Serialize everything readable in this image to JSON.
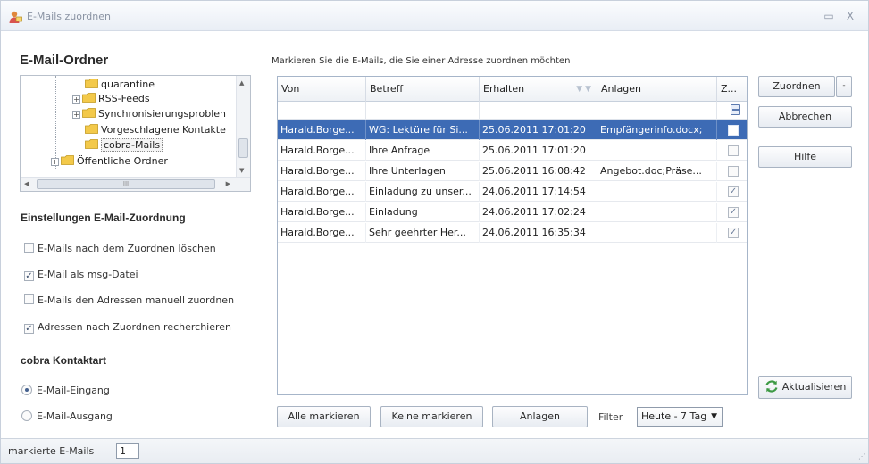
{
  "window": {
    "title": "E-Mails zuordnen",
    "minimize_glyph": "▭",
    "close_glyph": "X"
  },
  "folders": {
    "heading": "E-Mail-Ordner",
    "items": [
      {
        "label": "quarantine",
        "expander": ""
      },
      {
        "label": "RSS-Feeds",
        "expander": "+"
      },
      {
        "label": "Synchronisierungsproblen",
        "expander": "+"
      },
      {
        "label": "Vorgeschlagene Kontakte",
        "expander": ""
      },
      {
        "label": "cobra-Mails",
        "expander": ""
      },
      {
        "label": "Öffentliche Ordner",
        "expander": "+"
      }
    ],
    "scroll_thumb_text": "III"
  },
  "settings": {
    "heading": "Einstellungen E-Mail-Zuordnung",
    "options": [
      {
        "label": "E-Mails nach dem Zuordnen löschen",
        "checked": false,
        "mark": ""
      },
      {
        "label": "E-Mail als msg-Datei",
        "checked": true,
        "mark": "✓"
      },
      {
        "label": "E-Mails den Adressen manuell zuordnen",
        "checked": false,
        "mark": ""
      },
      {
        "label": "Adressen nach Zuordnen recherchieren",
        "checked": true,
        "mark": "✓"
      }
    ]
  },
  "kontaktart": {
    "heading": "cobra Kontaktart",
    "options": [
      {
        "label": "E-Mail-Eingang",
        "selected": true
      },
      {
        "label": "E-Mail-Ausgang",
        "selected": false
      }
    ]
  },
  "grid": {
    "instruction": "Markieren Sie die E-Mails, die Sie einer Adresse zuordnen möchten",
    "columns": [
      "Von",
      "Betreff",
      "Erhalten",
      "Anlagen",
      "Z..."
    ],
    "sort_glyph": "▼ ▼",
    "rows": [
      {
        "von": "Harald.Borge...",
        "betreff": "WG: Lektüre für Si...",
        "erhalten": "25.06.2011 17:01:20",
        "anlagen": "Empfängerinfo.docx;",
        "mark": "",
        "selected": true
      },
      {
        "von": "Harald.Borge...",
        "betreff": "Ihre Anfrage",
        "erhalten": "25.06.2011 17:01:20",
        "anlagen": "",
        "mark": "",
        "selected": false
      },
      {
        "von": "Harald.Borge...",
        "betreff": "Ihre Unterlagen",
        "erhalten": "25.06.2011 16:08:42",
        "anlagen": "Angebot.doc;Präse...",
        "mark": "",
        "selected": false
      },
      {
        "von": "Harald.Borge...",
        "betreff": "Einladung zu unser...",
        "erhalten": "24.06.2011 17:14:54",
        "anlagen": "",
        "mark": "✓",
        "selected": false
      },
      {
        "von": "Harald.Borge...",
        "betreff": "Einladung",
        "erhalten": "24.06.2011 17:02:24",
        "anlagen": "",
        "mark": "✓",
        "selected": false
      },
      {
        "von": "Harald.Borge...",
        "betreff": "Sehr geehrter Her...",
        "erhalten": "24.06.2011 16:35:34",
        "anlagen": "",
        "mark": "✓",
        "selected": false
      }
    ]
  },
  "bottom": {
    "mark_all": "Alle markieren",
    "mark_none": "Keine markieren",
    "attachments": "Anlagen",
    "filter_label": "Filter",
    "filter_value": "Heute - 7 Tag",
    "dropdown_glyph": "▼"
  },
  "actions": {
    "assign": "Zuordnen",
    "split_glyph": "-",
    "cancel": "Abbrechen",
    "help": "Hilfe",
    "refresh": "Aktualisieren"
  },
  "status": {
    "label": "markierte E-Mails",
    "count": "1",
    "grip": "⋰"
  },
  "colors": {
    "selection": "#3d6bb5",
    "folder": "#f3c94a",
    "refresh_green": "#3e9a45"
  }
}
